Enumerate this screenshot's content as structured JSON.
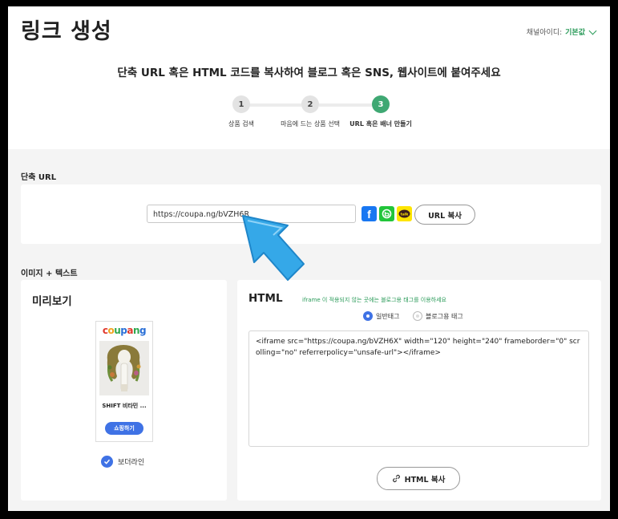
{
  "header": {
    "title": "링크 생성",
    "channel_label": "채널아이디:",
    "channel_value": "기본값",
    "headline": "단축 URL 혹은 HTML 코드를 복사하여 블로그 혹은 SNS, 웹사이트에 붙여주세요"
  },
  "steps": [
    {
      "number": "1",
      "label": "상품 검색"
    },
    {
      "number": "2",
      "label": "마음에 드는 상품 선택"
    },
    {
      "number": "3",
      "label": "URL 혹은 배너 만들기"
    }
  ],
  "short_url": {
    "section_label": "단축 URL",
    "url": "https://coupa.ng/bVZH6R",
    "copy_label": "URL 복사",
    "sns": {
      "facebook": "f",
      "band": "b",
      "kakao": "talk"
    }
  },
  "image_text": {
    "section_label": "이미지 + 텍스트",
    "preview_title": "미리보기",
    "banner": {
      "logo": "coupang",
      "logo_colors": [
        "#e0372b",
        "#f0a21c",
        "#2fa84f",
        "#2a6fd6",
        "#e0372b",
        "#2fa84f",
        "#2a6fd6"
      ],
      "product_name": "SHIFT 비타민 ...",
      "shop_label": "쇼핑하기"
    },
    "border_label": "보더라인"
  },
  "html": {
    "title": "HTML",
    "hint": "iframe 이 적용되지 않는 곳에는 블로그용 태그를 이용하세요",
    "radio_normal": "일반태그",
    "radio_blog": "블로그용 태그",
    "code": "<iframe src=\"https://coupa.ng/bVZH6X\" width=\"120\" height=\"240\" frameborder=\"0\" scrolling=\"no\" referrerpolicy=\"unsafe-url\"></iframe>",
    "copy_label": "HTML 복사"
  },
  "colors": {
    "accent": "#3f72e5",
    "green": "#3fa873",
    "arrow": "#35a8e8"
  }
}
